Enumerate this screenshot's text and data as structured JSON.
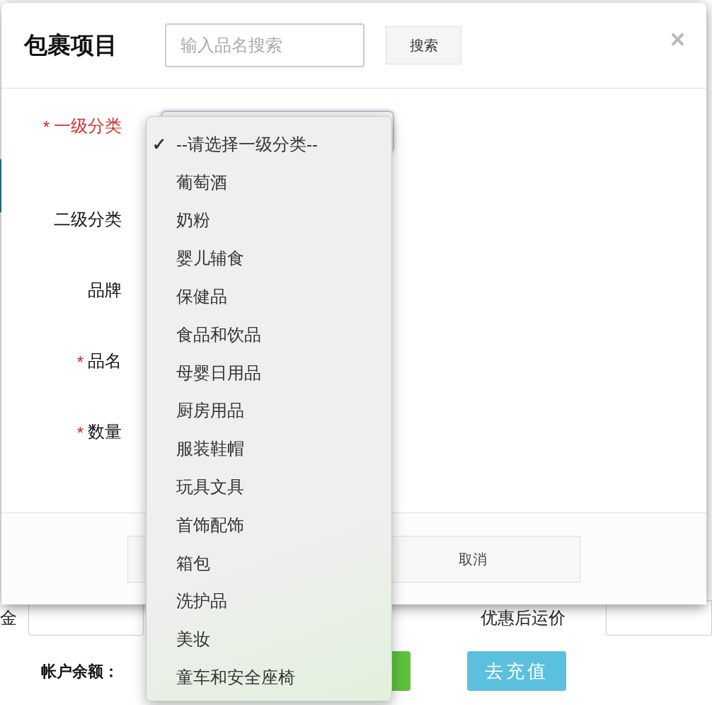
{
  "page": {
    "fields": [
      {
        "label": "金"
      },
      {
        "label": "优惠后运价"
      }
    ],
    "balance_label": "帐户余额：",
    "recharge_button": "去充值"
  },
  "dialog": {
    "title": "包裹项目",
    "search": {
      "placeholder": "输入品名搜索"
    },
    "search_button": "搜索",
    "close": "×",
    "required_mark": "*",
    "fields": [
      {
        "label": "一级分类",
        "required": true,
        "invalid": true
      },
      {
        "label": "二级分类",
        "required": false,
        "invalid": false
      },
      {
        "label": "品牌",
        "required": false,
        "invalid": false
      },
      {
        "label": "品名",
        "required": true,
        "invalid": false
      },
      {
        "label": "数量",
        "required": true,
        "invalid": false
      }
    ],
    "cancel_button": "取消",
    "category_dropdown": {
      "check": "✓",
      "options": [
        {
          "label": "--请选择一级分类--",
          "selected": true
        },
        {
          "label": "葡萄酒",
          "selected": false
        },
        {
          "label": "奶粉",
          "selected": false
        },
        {
          "label": "婴儿辅食",
          "selected": false
        },
        {
          "label": "保健品",
          "selected": false
        },
        {
          "label": "食品和饮品",
          "selected": false
        },
        {
          "label": "母婴日用品",
          "selected": false
        },
        {
          "label": "厨房用品",
          "selected": false
        },
        {
          "label": "服装鞋帽",
          "selected": false
        },
        {
          "label": "玩具文具",
          "selected": false
        },
        {
          "label": "首饰配饰",
          "selected": false
        },
        {
          "label": "箱包",
          "selected": false
        },
        {
          "label": "洗护品",
          "selected": false
        },
        {
          "label": "美妆",
          "selected": false
        },
        {
          "label": "童车和安全座椅",
          "selected": false
        }
      ]
    }
  }
}
